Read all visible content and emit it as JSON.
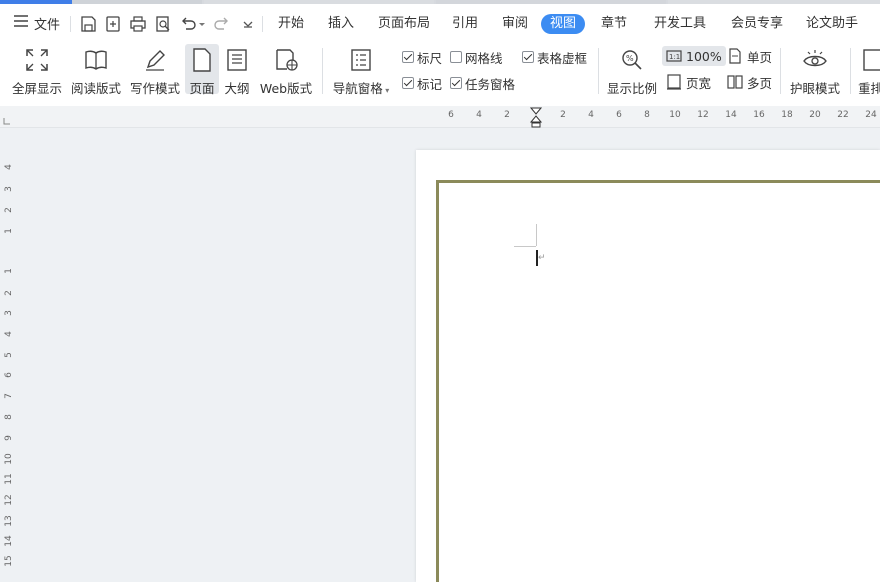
{
  "menubar": {
    "file_label": "文件",
    "tabs": [
      "开始",
      "插入",
      "页面布局",
      "引用",
      "审阅",
      "视图",
      "章节",
      "开发工具",
      "会员专享",
      "论文助手"
    ],
    "active_tab": "视图"
  },
  "ribbon": {
    "fullscreen": "全屏显示",
    "reading": "阅读版式",
    "writing": "写作模式",
    "page": "页面",
    "outline": "大纲",
    "web": "Web版式",
    "navpane": "导航窗格",
    "ruler": "标尺",
    "gridlines": "网格线",
    "table_gridlines": "表格虚框",
    "markup": "标记",
    "taskpane": "任务窗格",
    "zoom": "显示比例",
    "zoom_100": "100%",
    "single_page": "单页",
    "page_width": "页宽",
    "multi_page": "多页",
    "eye_care": "护眼模式",
    "rearrange": "重排"
  },
  "checks": {
    "ruler": true,
    "gridlines": false,
    "table_gridlines": true,
    "markup": true,
    "taskpane": true
  },
  "hruler_nums": [
    "6",
    "4",
    "2",
    "2",
    "4",
    "6",
    "8",
    "10",
    "12",
    "14",
    "16",
    "18",
    "20",
    "22",
    "24"
  ],
  "vruler_nums": [
    "4",
    "3",
    "2",
    "1",
    "1",
    "2",
    "3",
    "4",
    "5",
    "6",
    "7",
    "8",
    "9",
    "10",
    "11",
    "12",
    "13",
    "14",
    "15"
  ],
  "paragraph_mark": "↵",
  "colors": {
    "accent": "#3c8cf2",
    "page_border": "#8b8a5a",
    "topstrip_active": "#3f7ee8"
  }
}
